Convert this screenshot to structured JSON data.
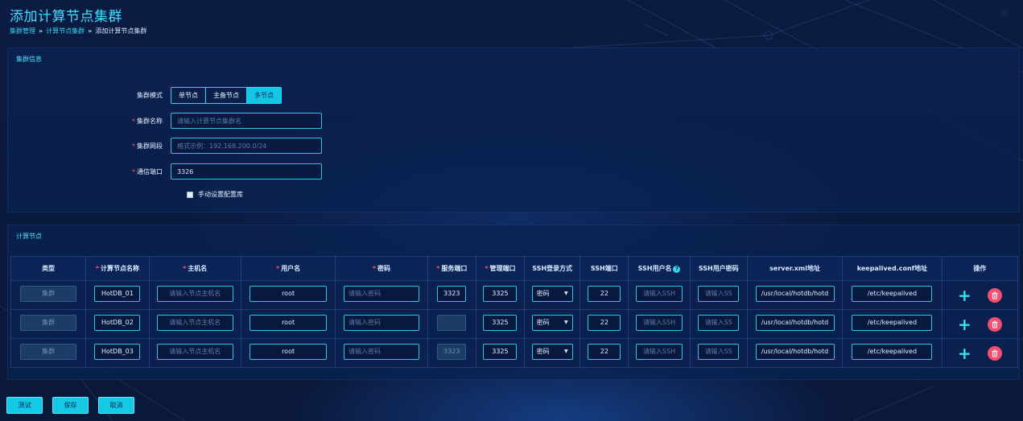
{
  "page": {
    "title": "添加计算节点集群",
    "breadcrumb": [
      "集群管理",
      "计算节点集群",
      "添加计算节点集群"
    ],
    "breadcrumb_sep": "»"
  },
  "cluster_info": {
    "title": "集群信息",
    "mode_label": "集群模式",
    "modes": [
      "单节点",
      "主备节点",
      "多节点"
    ],
    "active_mode": "多节点",
    "name_label": "集群名称",
    "name_placeholder": "请输入计算节点集群名",
    "network_label": "集群网段",
    "network_placeholder": "格式示例：192.168.200.0/24",
    "port_label": "通信端口",
    "port_value": "3326",
    "manual_db_label": "手动设置配置库",
    "manual_db_checked": false
  },
  "compute_nodes": {
    "title": "计算节点",
    "columns": [
      "类型",
      "计算节点名称",
      "主机名",
      "用户名",
      "密码",
      "服务端口",
      "管理端口",
      "SSH登录方式",
      "SSH端口",
      "SSH用户名",
      "SSH用户密码",
      "server.xml地址",
      "keepalived.conf地址",
      "操作"
    ],
    "rows": [
      {
        "type": "集群",
        "name": "HotDB_01",
        "host_placeholder": "请输入节点主机名",
        "user": "root",
        "pwd_placeholder": "请输入密码",
        "service_port": "3323",
        "manage_port": "3325",
        "ssh_login": "密码",
        "ssh_port": "22",
        "ssh_user_placeholder": "请输入SSH",
        "ssh_pwd_placeholder": "请输入SS",
        "server_xml": "/usr/local/hotdb/hotd",
        "keepalived": "/etc/keepalived"
      },
      {
        "type": "集群",
        "name": "HotDB_02",
        "host_placeholder": "请输入节点主机名",
        "user": "root",
        "pwd_placeholder": "请输入密码",
        "service_port": "",
        "manage_port": "3325",
        "ssh_login": "密码",
        "ssh_port": "22",
        "ssh_user_placeholder": "请输入SSH",
        "ssh_pwd_placeholder": "请输入SS",
        "server_xml": "/usr/local/hotdb/hotd",
        "keepalived": "/etc/keepalived"
      },
      {
        "type": "集群",
        "name": "HotDB_03",
        "host_placeholder": "请输入节点主机名",
        "user": "root",
        "pwd_placeholder": "请输入密码",
        "service_port": "3323",
        "manage_port": "3325",
        "ssh_login": "密码",
        "ssh_port": "22",
        "ssh_user_placeholder": "请输入SSH",
        "ssh_pwd_placeholder": "请输入SS",
        "server_xml": "/usr/local/hotdb/hotd",
        "keepalived": "/etc/keepalived"
      }
    ]
  },
  "footer": {
    "test_label": "测试",
    "save_label": "保存",
    "cancel_label": "取消"
  },
  "colors": {
    "accent": "#14c9e6",
    "danger": "#f24e72",
    "background": "#0a1a3e"
  },
  "icons": {
    "add": "plus-icon",
    "delete": "trash-icon",
    "help": "question-circle-icon",
    "dropdown": "caret-down-icon"
  }
}
